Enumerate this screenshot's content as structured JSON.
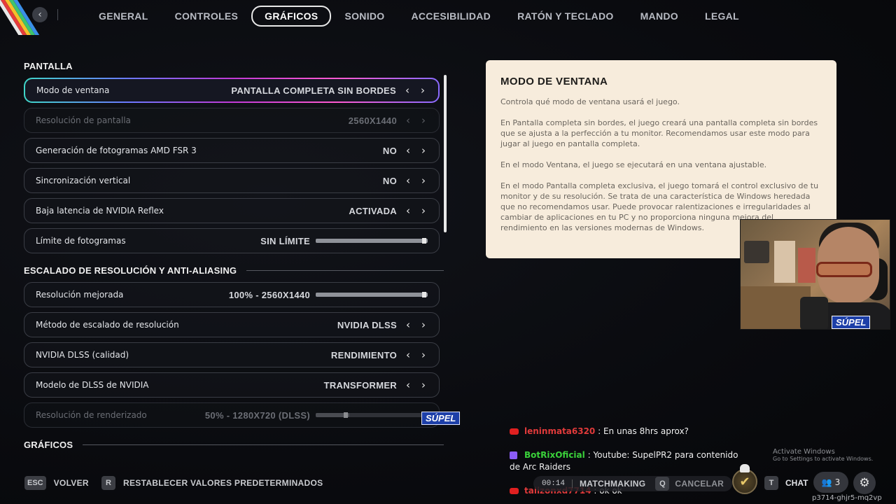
{
  "nav": {
    "back_icon": "chevron-left-icon",
    "tabs": [
      {
        "label": "GENERAL",
        "active": false
      },
      {
        "label": "CONTROLES",
        "active": false
      },
      {
        "label": "GRÁFICOS",
        "active": true
      },
      {
        "label": "SONIDO",
        "active": false
      },
      {
        "label": "ACCESIBILIDAD",
        "active": false
      },
      {
        "label": "RATÓN Y TECLADO",
        "active": false
      },
      {
        "label": "MANDO",
        "active": false
      },
      {
        "label": "LEGAL",
        "active": false
      }
    ]
  },
  "sections": {
    "pantalla": "PANTALLA",
    "escalado": "ESCALADO DE RESOLUCIÓN Y ANTI-ALIASING",
    "graficos": "GRÁFICOS"
  },
  "pantalla_rows": [
    {
      "label": "Modo de ventana",
      "value": "PANTALLA COMPLETA SIN BORDES"
    },
    {
      "label": "Resolución de pantalla",
      "value": "2560X1440"
    },
    {
      "label": "Generación de fotogramas AMD FSR 3",
      "value": "NO"
    },
    {
      "label": "Sincronización vertical",
      "value": "NO"
    },
    {
      "label": "Baja latencia de NVIDIA Reflex",
      "value": "ACTIVADA"
    },
    {
      "label": "Límite de fotogramas",
      "value": "SIN LÍMITE",
      "slider_level": 1.0
    }
  ],
  "escalado_rows": [
    {
      "label": "Resolución mejorada",
      "value": "100% - 2560X1440",
      "slider_level": 1.0
    },
    {
      "label": "Método de escalado de resolución",
      "value": "NVIDIA DLSS"
    },
    {
      "label": "NVIDIA DLSS (calidad)",
      "value": "RENDIMIENTO"
    },
    {
      "label": "Modelo de DLSS de NVIDIA",
      "value": "TRANSFORMER"
    },
    {
      "label": "Resolución de renderizado",
      "value": "50% - 1280X720 (DLSS)",
      "slider_level": 0.3
    }
  ],
  "info_panel": {
    "title": "MODO DE VENTANA",
    "paragraphs": [
      "Controla qué modo de ventana usará el juego.",
      "En Pantalla completa sin bordes, el juego creará una pantalla completa sin bordes que se ajusta a la perfección a tu monitor. Recomendamos usar este modo para jugar al juego en pantalla completa.",
      "En el modo Ventana, el juego se ejecutará en una ventana ajustable.",
      "En el modo Pantalla completa exclusiva, el juego tomará el control exclusivo de tu monitor y de su resolución. Se trata de una característica de Windows heredada que no recomendamos usar. Puede provocar ralentizaciones e irregularidades al cambiar de aplicaciones en tu PC y no proporciona ninguna mejora del rendimiento en las versiones modernas de Windows."
    ]
  },
  "stream_overlay": {
    "webcam_tag": "SÚPEL",
    "small_tag": "SÚPEL"
  },
  "chat": [
    {
      "platform": "youtube",
      "user": "leninmata6320",
      "text": "En unas 8hrs aprox?"
    },
    {
      "platform": "twitch",
      "user": "BotRixOficial",
      "text": "Youtube: SupelPR2 para contenido de Arc Raiders"
    },
    {
      "platform": "youtube",
      "user": "taiizonxd7714",
      "text": "ok ok"
    }
  ],
  "windows_watermark": {
    "line1": "Activate Windows",
    "line2": "Go to Settings to activate Windows."
  },
  "bottom_bar": {
    "esc_key": "ESC",
    "back_label": "VOLVER",
    "r_key": "R",
    "reset_label": "RESTABLECER VALORES PREDETERMINADOS",
    "timer": "00:14",
    "matchmaking_label": "MATCHMAKING",
    "q_key": "Q",
    "cancel_label": "CANCELAR",
    "t_key": "T",
    "chat_label": "CHAT",
    "friends_count": "3"
  },
  "session_code": "p3714-ghjr5-mq2vp",
  "colors": {
    "info_bg": "#f7ecdc",
    "accent_gradient": [
      "#3fd6c8",
      "#6b79ff",
      "#c13ad6",
      "#ff5ad1"
    ],
    "youtube_red": "#e02020",
    "twitch_purple": "#8b5cf6"
  }
}
